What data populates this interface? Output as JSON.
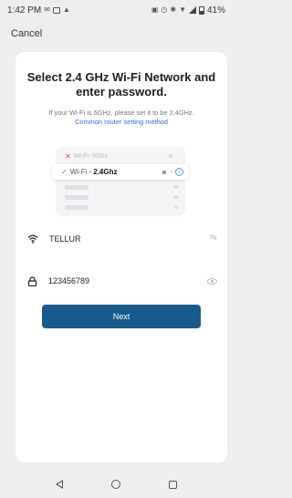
{
  "status_bar": {
    "time": "1:42 PM",
    "battery": "41%"
  },
  "header": {
    "cancel_label": "Cancel"
  },
  "main": {
    "title": "Select 2.4 GHz Wi-Fi Network and enter password.",
    "subtitle": "If your Wi-Fi is 5GHz, please set it to be 2.4GHz.",
    "link_text": "Common router setting method",
    "illustration": {
      "wifi_5_prefix": "Wi-Fi - ",
      "wifi_5_band": "5Ghz",
      "wifi_24_prefix": "Wi-Fi - ",
      "wifi_24_band": "2.4Ghz"
    },
    "network_name": "TELLUR",
    "password": "123456789",
    "next_label": "Next"
  },
  "colors": {
    "primary_button": "#175a8c",
    "link": "#2d6bd6",
    "error": "#e04a3a",
    "success": "#34a853"
  }
}
